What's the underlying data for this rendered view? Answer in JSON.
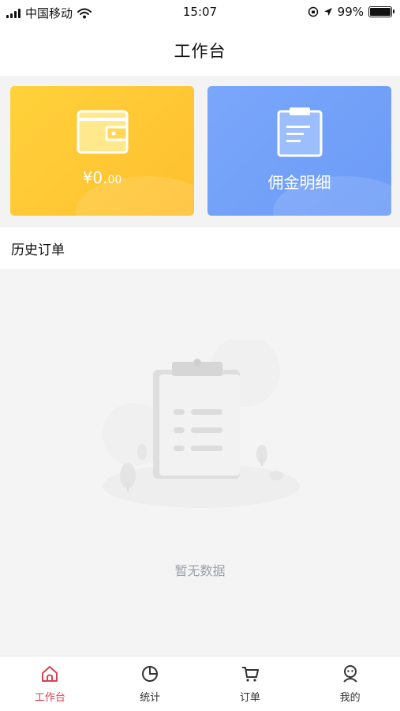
{
  "status_bar": {
    "carrier": "中国移动",
    "time": "15:07",
    "battery": "99%"
  },
  "header": {
    "title": "工作台"
  },
  "cards": {
    "wallet": {
      "amount_main": "¥0.",
      "amount_decimal": "00",
      "icon": "wallet-icon",
      "color": "#ffc52f"
    },
    "commission": {
      "label": "佣金明细",
      "icon": "clipboard-icon",
      "color": "#709ff8"
    }
  },
  "history": {
    "title": "历史订单",
    "empty_text": "暂无数据"
  },
  "tabs": [
    {
      "label": "工作台",
      "icon": "home-icon",
      "active": true
    },
    {
      "label": "统计",
      "icon": "pie-chart-icon",
      "active": false
    },
    {
      "label": "订单",
      "icon": "cart-icon",
      "active": false
    },
    {
      "label": "我的",
      "icon": "profile-icon",
      "active": false
    }
  ],
  "colors": {
    "accent": "#d8424e"
  }
}
